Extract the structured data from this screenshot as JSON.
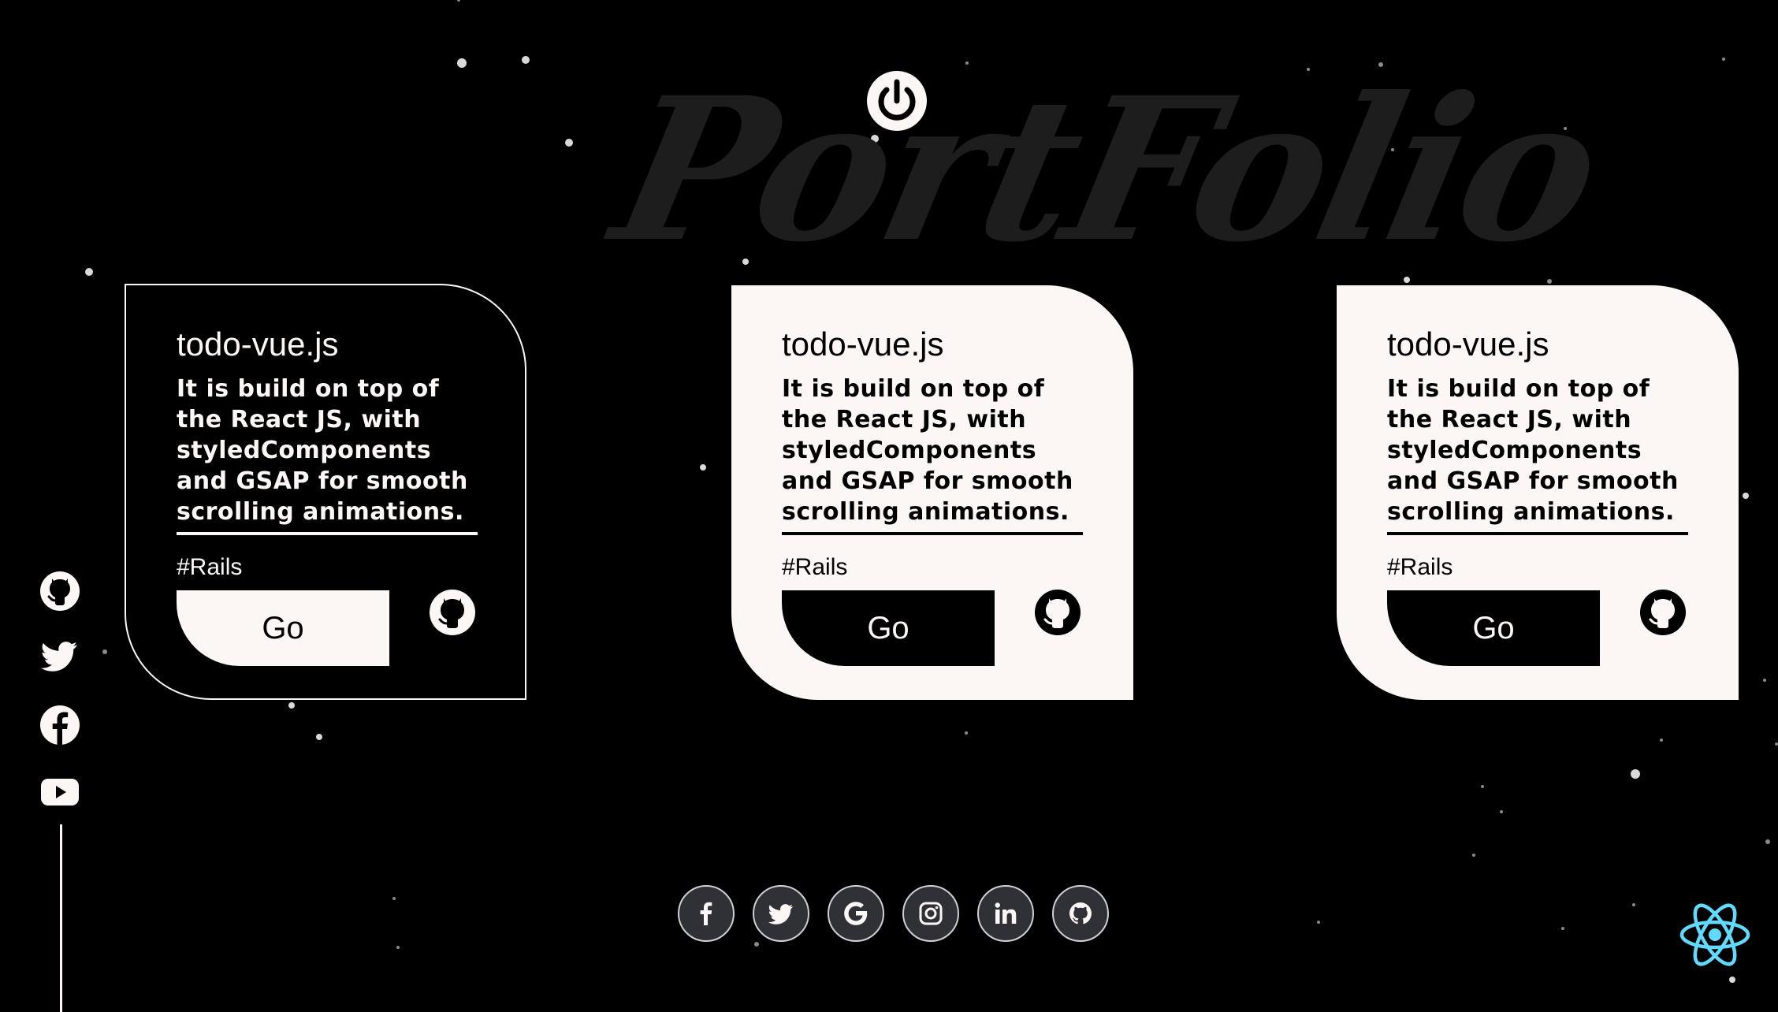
{
  "background_title": "PortFolio",
  "colors": {
    "background": "#000000",
    "card_light": "#fcf6f4",
    "card_dark": "#000000",
    "footer_icon_bg": "#2f3137",
    "react_accent": "#61dafb"
  },
  "header": {
    "power_icon": "power-icon"
  },
  "projects": [
    {
      "title": "todo-vue.js",
      "description": "It is build on top of the React JS, with styledComponents and GSAP for smooth scrolling animations.",
      "tag": "#Rails",
      "button_label": "Go",
      "repo_icon": "github-icon",
      "theme": "dark"
    },
    {
      "title": "todo-vue.js",
      "description": "It is build on top of the React JS, with styledComponents and GSAP for smooth scrolling animations.",
      "tag": "#Rails",
      "button_label": "Go",
      "repo_icon": "github-icon",
      "theme": "light"
    },
    {
      "title": "todo-vue.js",
      "description": "It is build on top of the React JS, with styledComponents and GSAP for smooth scrolling animations.",
      "tag": "#Rails",
      "button_label": "Go",
      "repo_icon": "github-icon",
      "theme": "light"
    }
  ],
  "side_social": [
    "github-icon",
    "twitter-icon",
    "facebook-icon",
    "youtube-icon"
  ],
  "footer_social": [
    "facebook-icon",
    "twitter-icon",
    "google-icon",
    "instagram-icon",
    "linkedin-icon",
    "github-icon"
  ],
  "corner_logo": "react-icon"
}
